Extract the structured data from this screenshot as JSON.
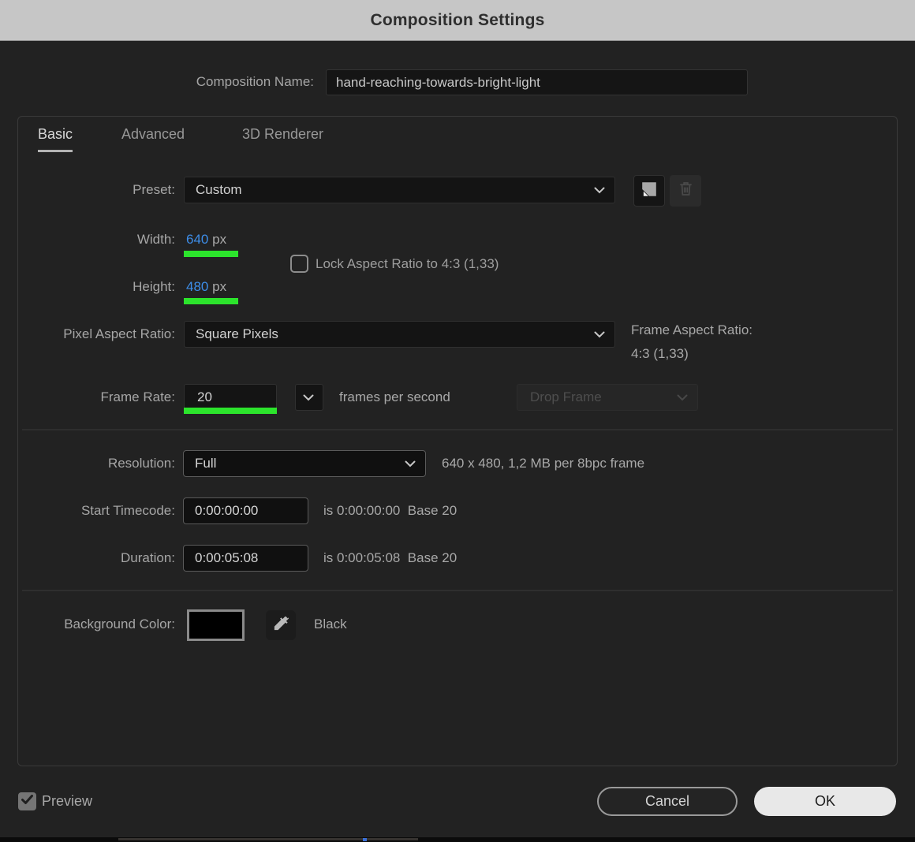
{
  "titlebar": {
    "title": "Composition Settings"
  },
  "composition_name": {
    "label": "Composition Name:",
    "value": "hand-reaching-towards-bright-light"
  },
  "tabs": [
    {
      "label": "Basic",
      "active": true
    },
    {
      "label": "Advanced",
      "active": false
    },
    {
      "label": "3D Renderer",
      "active": false
    }
  ],
  "preset": {
    "label": "Preset:",
    "value": "Custom"
  },
  "dimensions": {
    "width_label": "Width:",
    "width_value": "640",
    "width_unit": "px",
    "height_label": "Height:",
    "height_value": "480",
    "height_unit": "px",
    "lock_label": "Lock Aspect Ratio to 4:3 (1,33)",
    "lock_checked": false
  },
  "pixel_aspect": {
    "label": "Pixel Aspect Ratio:",
    "value": "Square Pixels",
    "frame_aspect_label": "Frame Aspect Ratio:",
    "frame_aspect_value": "4:3 (1,33)"
  },
  "frame_rate": {
    "label": "Frame Rate:",
    "value": "20",
    "unit": "frames per second",
    "drop_frame_value": "Drop Frame",
    "drop_frame_enabled": false
  },
  "resolution": {
    "label": "Resolution:",
    "value": "Full",
    "info": "640 x 480, 1,2 MB per 8bpc frame"
  },
  "start_timecode": {
    "label": "Start Timecode:",
    "value": "0:00:00:00",
    "info": "is 0:00:00:00  Base 20"
  },
  "duration": {
    "label": "Duration:",
    "value": "0:00:05:08",
    "info": "is 0:00:05:08  Base 20"
  },
  "background_color": {
    "label": "Background Color:",
    "swatch_color": "#000000",
    "color_name": "Black"
  },
  "footer": {
    "preview_label": "Preview",
    "preview_checked": true,
    "cancel_label": "Cancel",
    "ok_label": "OK"
  },
  "icons": [
    "chevron-down-icon",
    "save-preset-icon",
    "trash-icon",
    "eyedropper-icon",
    "checkmark-icon"
  ],
  "colors": {
    "accent_blue": "#3d8de8",
    "highlight_green": "#2ce42c",
    "titlebar_bg": "#c6c6c6",
    "dialog_bg": "#222222",
    "background_color_value": "#000000"
  }
}
